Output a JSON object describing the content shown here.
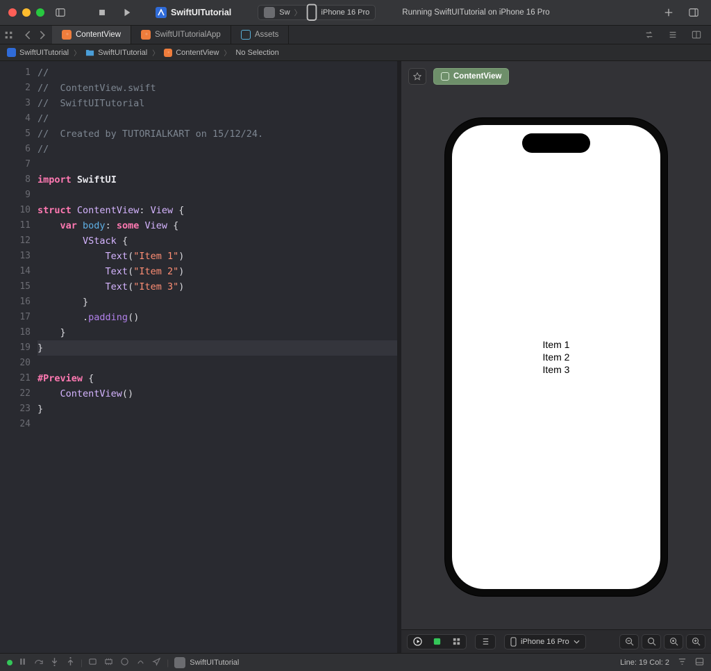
{
  "window": {
    "project_name": "SwiftUITutorial",
    "scheme_short": "Sw",
    "device": "iPhone 16 Pro",
    "status": "Running SwiftUITutorial on iPhone 16 Pro"
  },
  "tabs": [
    {
      "label": "ContentView",
      "icon": "swift",
      "active": true
    },
    {
      "label": "SwiftUITutorialApp",
      "icon": "swift",
      "active": false
    },
    {
      "label": "Assets",
      "icon": "assets",
      "active": false
    }
  ],
  "breadcrumb": {
    "project": "SwiftUITutorial",
    "folder": "SwiftUITutorial",
    "file": "ContentView",
    "selection": "No Selection"
  },
  "code": {
    "lines": [
      {
        "n": 1,
        "raw": "//"
      },
      {
        "n": 2,
        "raw": "//  ContentView.swift"
      },
      {
        "n": 3,
        "raw": "//  SwiftUITutorial"
      },
      {
        "n": 4,
        "raw": "//"
      },
      {
        "n": 5,
        "raw": "//  Created by TUTORIALKART on 15/12/24."
      },
      {
        "n": 6,
        "raw": "//"
      },
      {
        "n": 7,
        "raw": ""
      },
      {
        "n": 8,
        "raw": "import SwiftUI"
      },
      {
        "n": 9,
        "raw": ""
      },
      {
        "n": 10,
        "raw": "struct ContentView: View {"
      },
      {
        "n": 11,
        "raw": "    var body: some View {"
      },
      {
        "n": 12,
        "raw": "        VStack {"
      },
      {
        "n": 13,
        "raw": "            Text(\"Item 1\")"
      },
      {
        "n": 14,
        "raw": "            Text(\"Item 2\")"
      },
      {
        "n": 15,
        "raw": "            Text(\"Item 3\")"
      },
      {
        "n": 16,
        "raw": "        }"
      },
      {
        "n": 17,
        "raw": "        .padding()"
      },
      {
        "n": 18,
        "raw": "    }"
      },
      {
        "n": 19,
        "raw": "}"
      },
      {
        "n": 20,
        "raw": ""
      },
      {
        "n": 21,
        "raw": "#Preview {"
      },
      {
        "n": 22,
        "raw": "    ContentView()"
      },
      {
        "n": 23,
        "raw": "}"
      },
      {
        "n": 24,
        "raw": ""
      }
    ],
    "highlight_line": 19
  },
  "preview": {
    "label": "ContentView",
    "device": "iPhone 16 Pro",
    "items": [
      "Item 1",
      "Item 2",
      "Item 3"
    ]
  },
  "status_bar": {
    "target": "SwiftUITutorial",
    "cursor": "Line: 19  Col: 2"
  }
}
